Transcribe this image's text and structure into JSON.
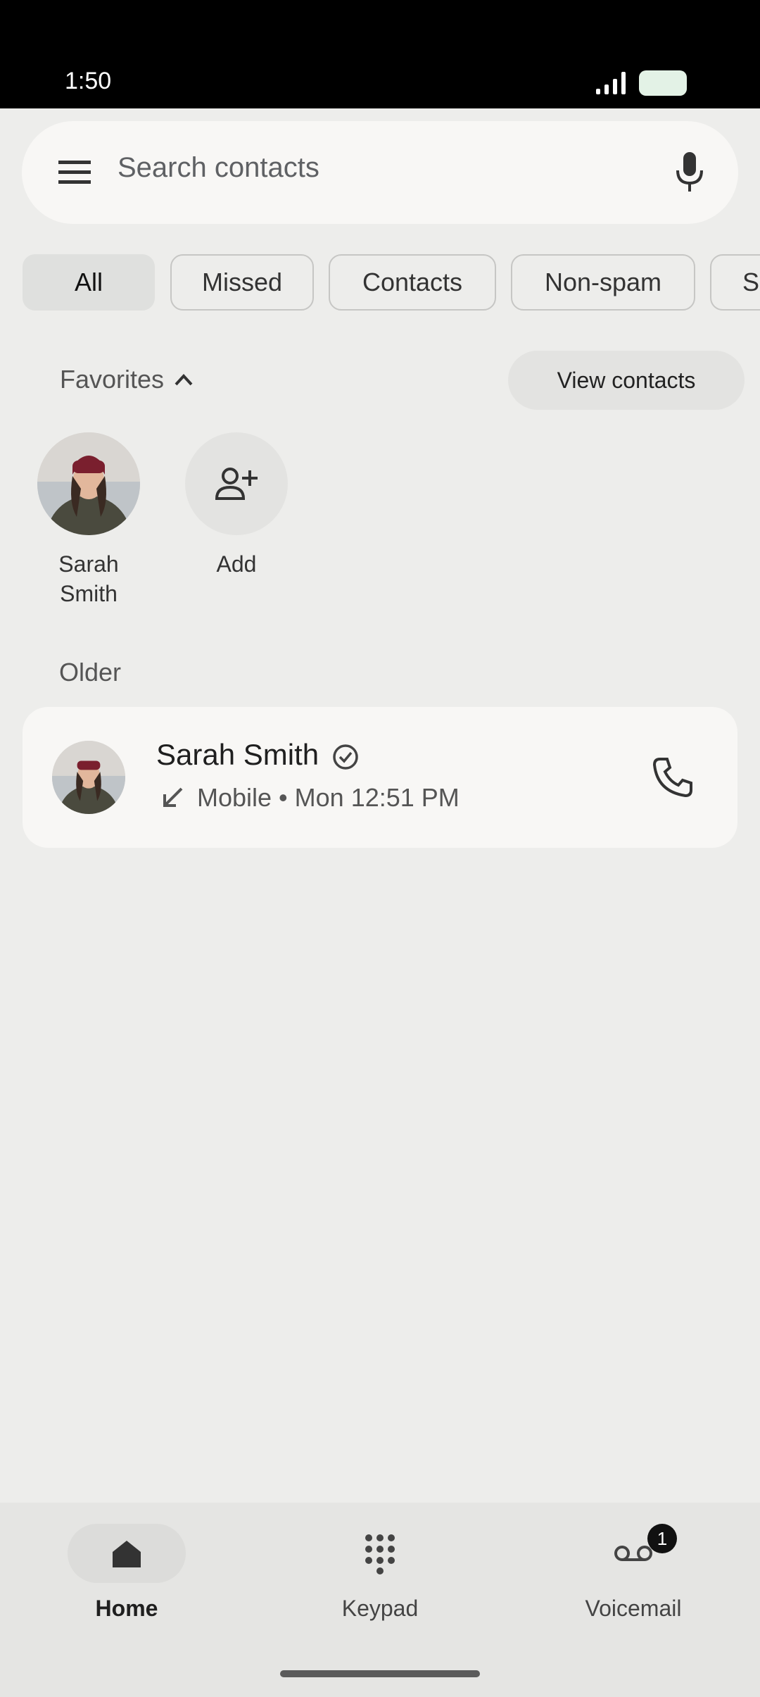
{
  "status_bar": {
    "time": "1:50",
    "signal_icon": "signal-icon",
    "battery_icon": "battery-icon"
  },
  "search": {
    "placeholder": "Search contacts",
    "menu_icon": "menu-icon",
    "mic_icon": "mic-icon"
  },
  "filters": [
    {
      "label": "All",
      "active": true
    },
    {
      "label": "Missed",
      "active": false
    },
    {
      "label": "Contacts",
      "active": false
    },
    {
      "label": "Non-spam",
      "active": false
    },
    {
      "label": "Sp",
      "active": false
    }
  ],
  "favorites": {
    "header": "Favorites",
    "view_contacts_label": "View contacts",
    "items": [
      {
        "name": "Sarah Smith"
      },
      {
        "name": "Add"
      }
    ]
  },
  "recents": {
    "section": "Older",
    "calls": [
      {
        "name": "Sarah Smith",
        "detail": "Mobile • Mon 12:51 PM",
        "direction_icon": "incoming-call-arrow-icon",
        "verified_icon": "verified-check-icon",
        "action_icon": "phone-icon"
      }
    ]
  },
  "nav": {
    "items": [
      {
        "label": "Home",
        "icon": "home-icon",
        "active": true
      },
      {
        "label": "Keypad",
        "icon": "keypad-icon",
        "active": false
      },
      {
        "label": "Voicemail",
        "icon": "voicemail-icon",
        "active": false,
        "badge": "1"
      }
    ]
  },
  "colors": {
    "background": "#ededeb",
    "card": "#f8f7f5",
    "active_chip": "#dfe0de"
  }
}
